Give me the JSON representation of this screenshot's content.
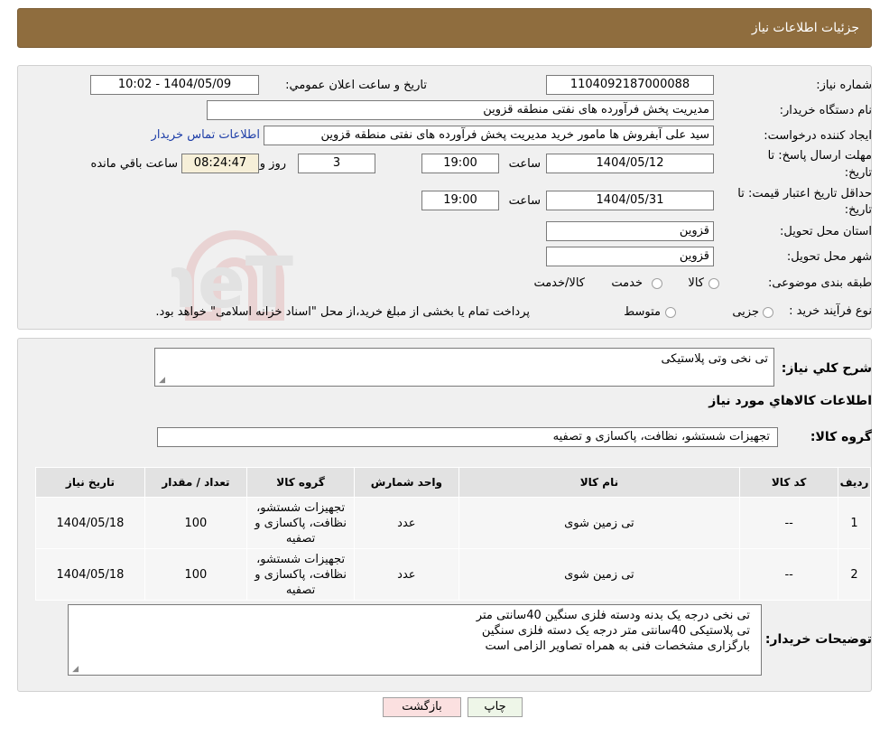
{
  "header": {
    "title": "جزئیات اطلاعات نیاز"
  },
  "form": {
    "need_number_label": "شماره نیاز:",
    "need_number": "1104092187000088",
    "announce_label": "تاریخ و ساعت اعلان عمومي:",
    "announce_value": "1404/05/09 - 10:02",
    "buyer_org_label": "نام دستگاه خريدار:",
    "buyer_org": "مدیریت پخش فرآورده های نفتی منطقه قزوین",
    "creator_label": "ايجاد كننده درخواست:",
    "creator": "سید علی  آبفروش ها مامور خرید مدیریت پخش فرآورده های نفتی منطقه قزوین",
    "contact_link": "اطلاعات تماس خریدار",
    "deadline_label_1": "مهلت ارسال پاسخ: تا",
    "deadline_label_2": "تاريخ:",
    "deadline_date": "1404/05/12",
    "time_label": "ساعت",
    "deadline_time": "19:00",
    "days_value": "3",
    "days_label": "روز و",
    "remaining_time": "08:24:47",
    "remaining_label": "ساعت باقي مانده",
    "validity_label_1": "حداقل تاريخ اعتبار قيمت: تا",
    "validity_label_2": "تاريخ:",
    "validity_date": "1404/05/31",
    "validity_time": "19:00",
    "province_label": "استان محل تحويل:",
    "province": "قزوین",
    "city_label": "شهر محل تحويل:",
    "city": "قزوین",
    "category_label": "طبقه بندی موضوعی:",
    "category_options": [
      "کالا",
      "خدمت",
      "کالا/خدمت"
    ],
    "purchase_type_label": "نوع فرآیند خرید :",
    "purchase_options": [
      "جزیی",
      "متوسط"
    ],
    "purchase_note": "پرداخت تمام یا بخشی از مبلغ خرید،از محل \"اسناد خزانه اسلامی\" خواهد بود."
  },
  "summary": {
    "label": "شرح كلي نياز:",
    "value": "تی نخی وتی پلاستیکی",
    "goods_info_title": "اطلاعات كالاهاي مورد نياز",
    "goods_group_label": "گروه كالا:",
    "goods_group": "تجهیزات شستشو، نظافت، پاکسازی و تصفیه"
  },
  "table": {
    "headers": [
      "رديف",
      "كد كالا",
      "نام كالا",
      "واحد شمارش",
      "گروه كالا",
      "تعداد / مقدار",
      "تاريخ نياز"
    ],
    "rows": [
      [
        "1",
        "--",
        "تی زمین شوی",
        "عدد",
        "تجهیزات شستشو، نظافت، پاکسازی و تصفیه",
        "100",
        "1404/05/18"
      ],
      [
        "2",
        "--",
        "تی زمین شوی",
        "عدد",
        "تجهیزات شستشو، نظافت، پاکسازی و تصفیه",
        "100",
        "1404/05/18"
      ]
    ]
  },
  "buyer_notes": {
    "label": "توضیحات خریدار:",
    "lines": [
      "تی نخی  درجه یک بدنه ودسته فلزی سنگین 40سانتی متر",
      "تی پلاستیکی 40سانتی متر درجه یک دسته فلزی سنگین",
      "بارگزاری مشخصات فنی به همراه تصاویر الزامی است"
    ]
  },
  "buttons": {
    "print": "چاپ",
    "back": "بازگشت"
  },
  "watermark": "AriaTender.neT",
  "colors": {
    "header_bg": "#8f6d3e",
    "back_button_bg": "#fbe0e0",
    "print_button_bg": "#eef6e8",
    "link": "#1f3fa8"
  }
}
